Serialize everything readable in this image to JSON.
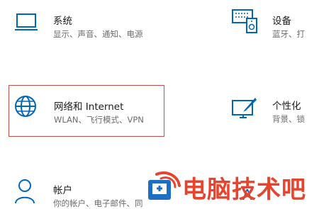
{
  "tiles": {
    "system": {
      "title": "系统",
      "desc": "显示、声音、通知、电源",
      "icon": "laptop-icon"
    },
    "devices": {
      "title": "设备",
      "desc": "蓝牙、打",
      "icon": "devices-icon"
    },
    "network": {
      "title": "网络和 Internet",
      "desc": "WLAN、飞行模式、VPN",
      "icon": "globe-icon"
    },
    "personal": {
      "title": "个性化",
      "desc": "背景、锁",
      "icon": "personalization-icon"
    },
    "accounts": {
      "title": "帐户",
      "desc": "你的帐户、电子邮件、同",
      "icon": "person-icon"
    },
    "last": {
      "title": "",
      "desc": "",
      "icon": "time-language-icon"
    }
  },
  "watermark": {
    "text": "电脑技术吧",
    "color": "#e8432d"
  },
  "colors": {
    "accent": "#0067b8",
    "highlight_border": "#c0504d"
  }
}
